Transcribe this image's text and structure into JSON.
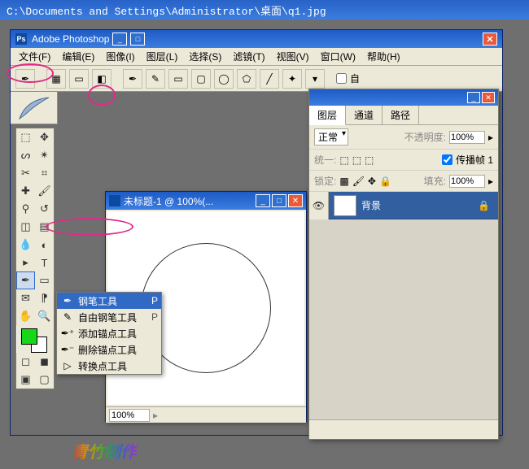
{
  "outer": {
    "path": "C:\\Documents and Settings\\Administrator\\桌面\\q1.jpg"
  },
  "ps": {
    "title": "Adobe Photoshop"
  },
  "menu": {
    "file": "文件(F)",
    "edit": "编辑(E)",
    "image": "图像(I)",
    "layer": "图层(L)",
    "select": "选择(S)",
    "filter": "滤镜(T)",
    "view": "视图(V)",
    "window": "窗口(W)",
    "help": "帮助(H)"
  },
  "options": {
    "auto_label": "自"
  },
  "doc": {
    "title": "未标题-1 @ 100%(...",
    "zoom": "100%"
  },
  "flyout": {
    "items": [
      {
        "icon": "✒",
        "label": "钢笔工具",
        "key": "P"
      },
      {
        "icon": "✎",
        "label": "自由钢笔工具",
        "key": "P"
      },
      {
        "icon": "+",
        "label": "添加锚点工具",
        "key": ""
      },
      {
        "icon": "−",
        "label": "删除锚点工具",
        "key": ""
      },
      {
        "icon": "▷",
        "label": "转换点工具",
        "key": ""
      }
    ]
  },
  "layers": {
    "tabs": {
      "layers": "图层",
      "channels": "通道",
      "paths": "路径"
    },
    "blend_label": "正常",
    "opacity_label": "不透明度:",
    "opacity_value": "100%",
    "unify_label": "统一:",
    "propagate_label": "传播帧 1",
    "lock_label": "锁定:",
    "fill_label": "填充:",
    "fill_value": "100%",
    "layer_name": "背景"
  },
  "watermark": "青竹制作"
}
